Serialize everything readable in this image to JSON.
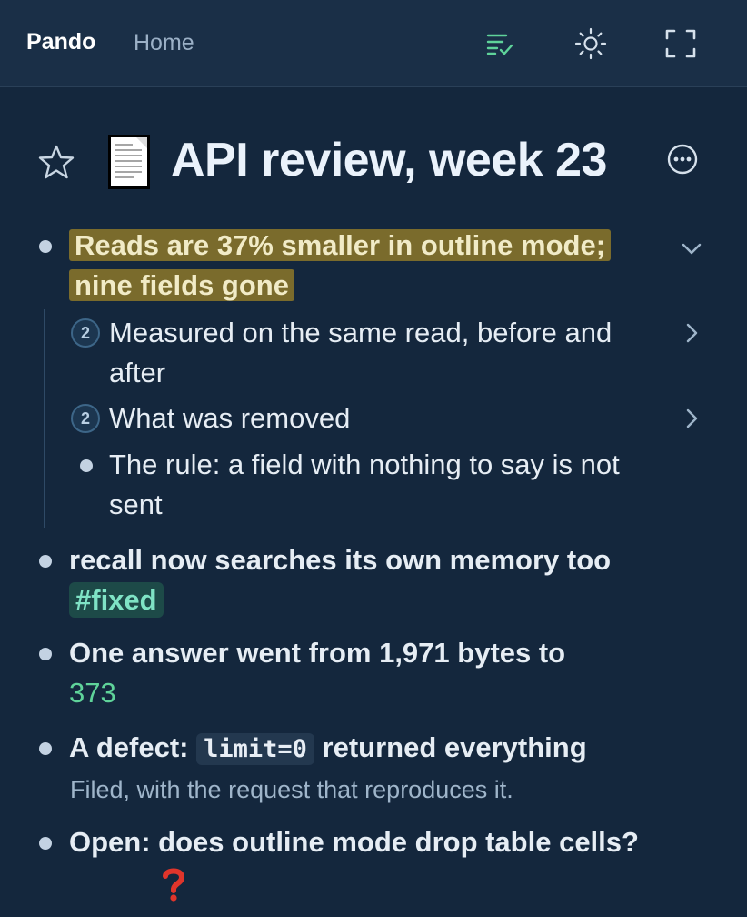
{
  "header": {
    "brand": "Pando",
    "home_link": "Home",
    "icons": [
      "outline-icon",
      "sun-icon",
      "fullscreen-icon"
    ],
    "accent_color": "#5fd39a"
  },
  "page": {
    "emoji": "page-emoji",
    "title": "API review, week 23"
  },
  "items": {
    "item1": {
      "text_a": "Reads are 37% smaller in outline mode;",
      "text_b": "nine fields gone",
      "highlight_color": "#7a6b2c",
      "children": {
        "c1": {
          "count": "2",
          "text": "Measured on the same read, before and after"
        },
        "c2": {
          "count": "2",
          "text": "What was removed"
        },
        "c3": {
          "text": "The rule: a field with nothing to say is not sent"
        }
      }
    },
    "item2": {
      "text": "recall now searches its own memory too",
      "tag": "#fixed"
    },
    "item3": {
      "text_before": "One answer went from 1,971 bytes to",
      "value": "373"
    },
    "item4": {
      "text_before": "A defect:",
      "code": "limit=0",
      "text_after": "returned everything",
      "note": "Filed, with the request that reproduces it."
    },
    "item5": {
      "text": "Open: does outline mode drop table cells?",
      "emoji": "question-mark"
    }
  }
}
